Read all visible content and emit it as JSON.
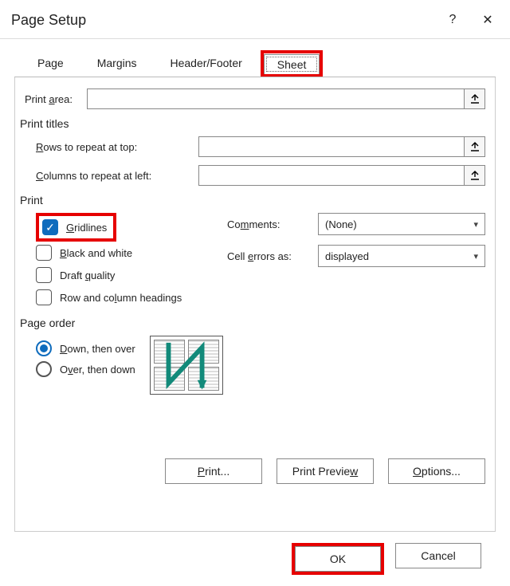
{
  "title": "Page Setup",
  "titlebar": {
    "help": "?",
    "close": "✕"
  },
  "tabs": {
    "page": "Page",
    "margins": "Margins",
    "headerfooter": "Header/Footer",
    "sheet": "Sheet"
  },
  "sheet": {
    "print_area_label": "Print area:",
    "print_area_value": "",
    "print_titles_label": "Print titles",
    "rows_repeat_label": "Rows to repeat at top:",
    "rows_repeat_value": "",
    "cols_repeat_label": "Columns to repeat at left:",
    "cols_repeat_value": "",
    "print_section_label": "Print",
    "gridlines_label": "Gridlines",
    "bw_label": "Black and white",
    "draft_label": "Draft quality",
    "rowcol_label": "Row and column headings",
    "comments_label": "Comments:",
    "comments_value": "(None)",
    "cellerrors_label": "Cell errors as:",
    "cellerrors_value": "displayed",
    "page_order_label": "Page order",
    "down_over_label": "Down, then over",
    "over_down_label": "Over, then down"
  },
  "buttons": {
    "print": "Print...",
    "preview": "Print Preview",
    "options": "Options...",
    "ok": "OK",
    "cancel": "Cancel"
  },
  "state": {
    "active_tab": "sheet",
    "gridlines_checked": true,
    "page_order": "down_over"
  }
}
